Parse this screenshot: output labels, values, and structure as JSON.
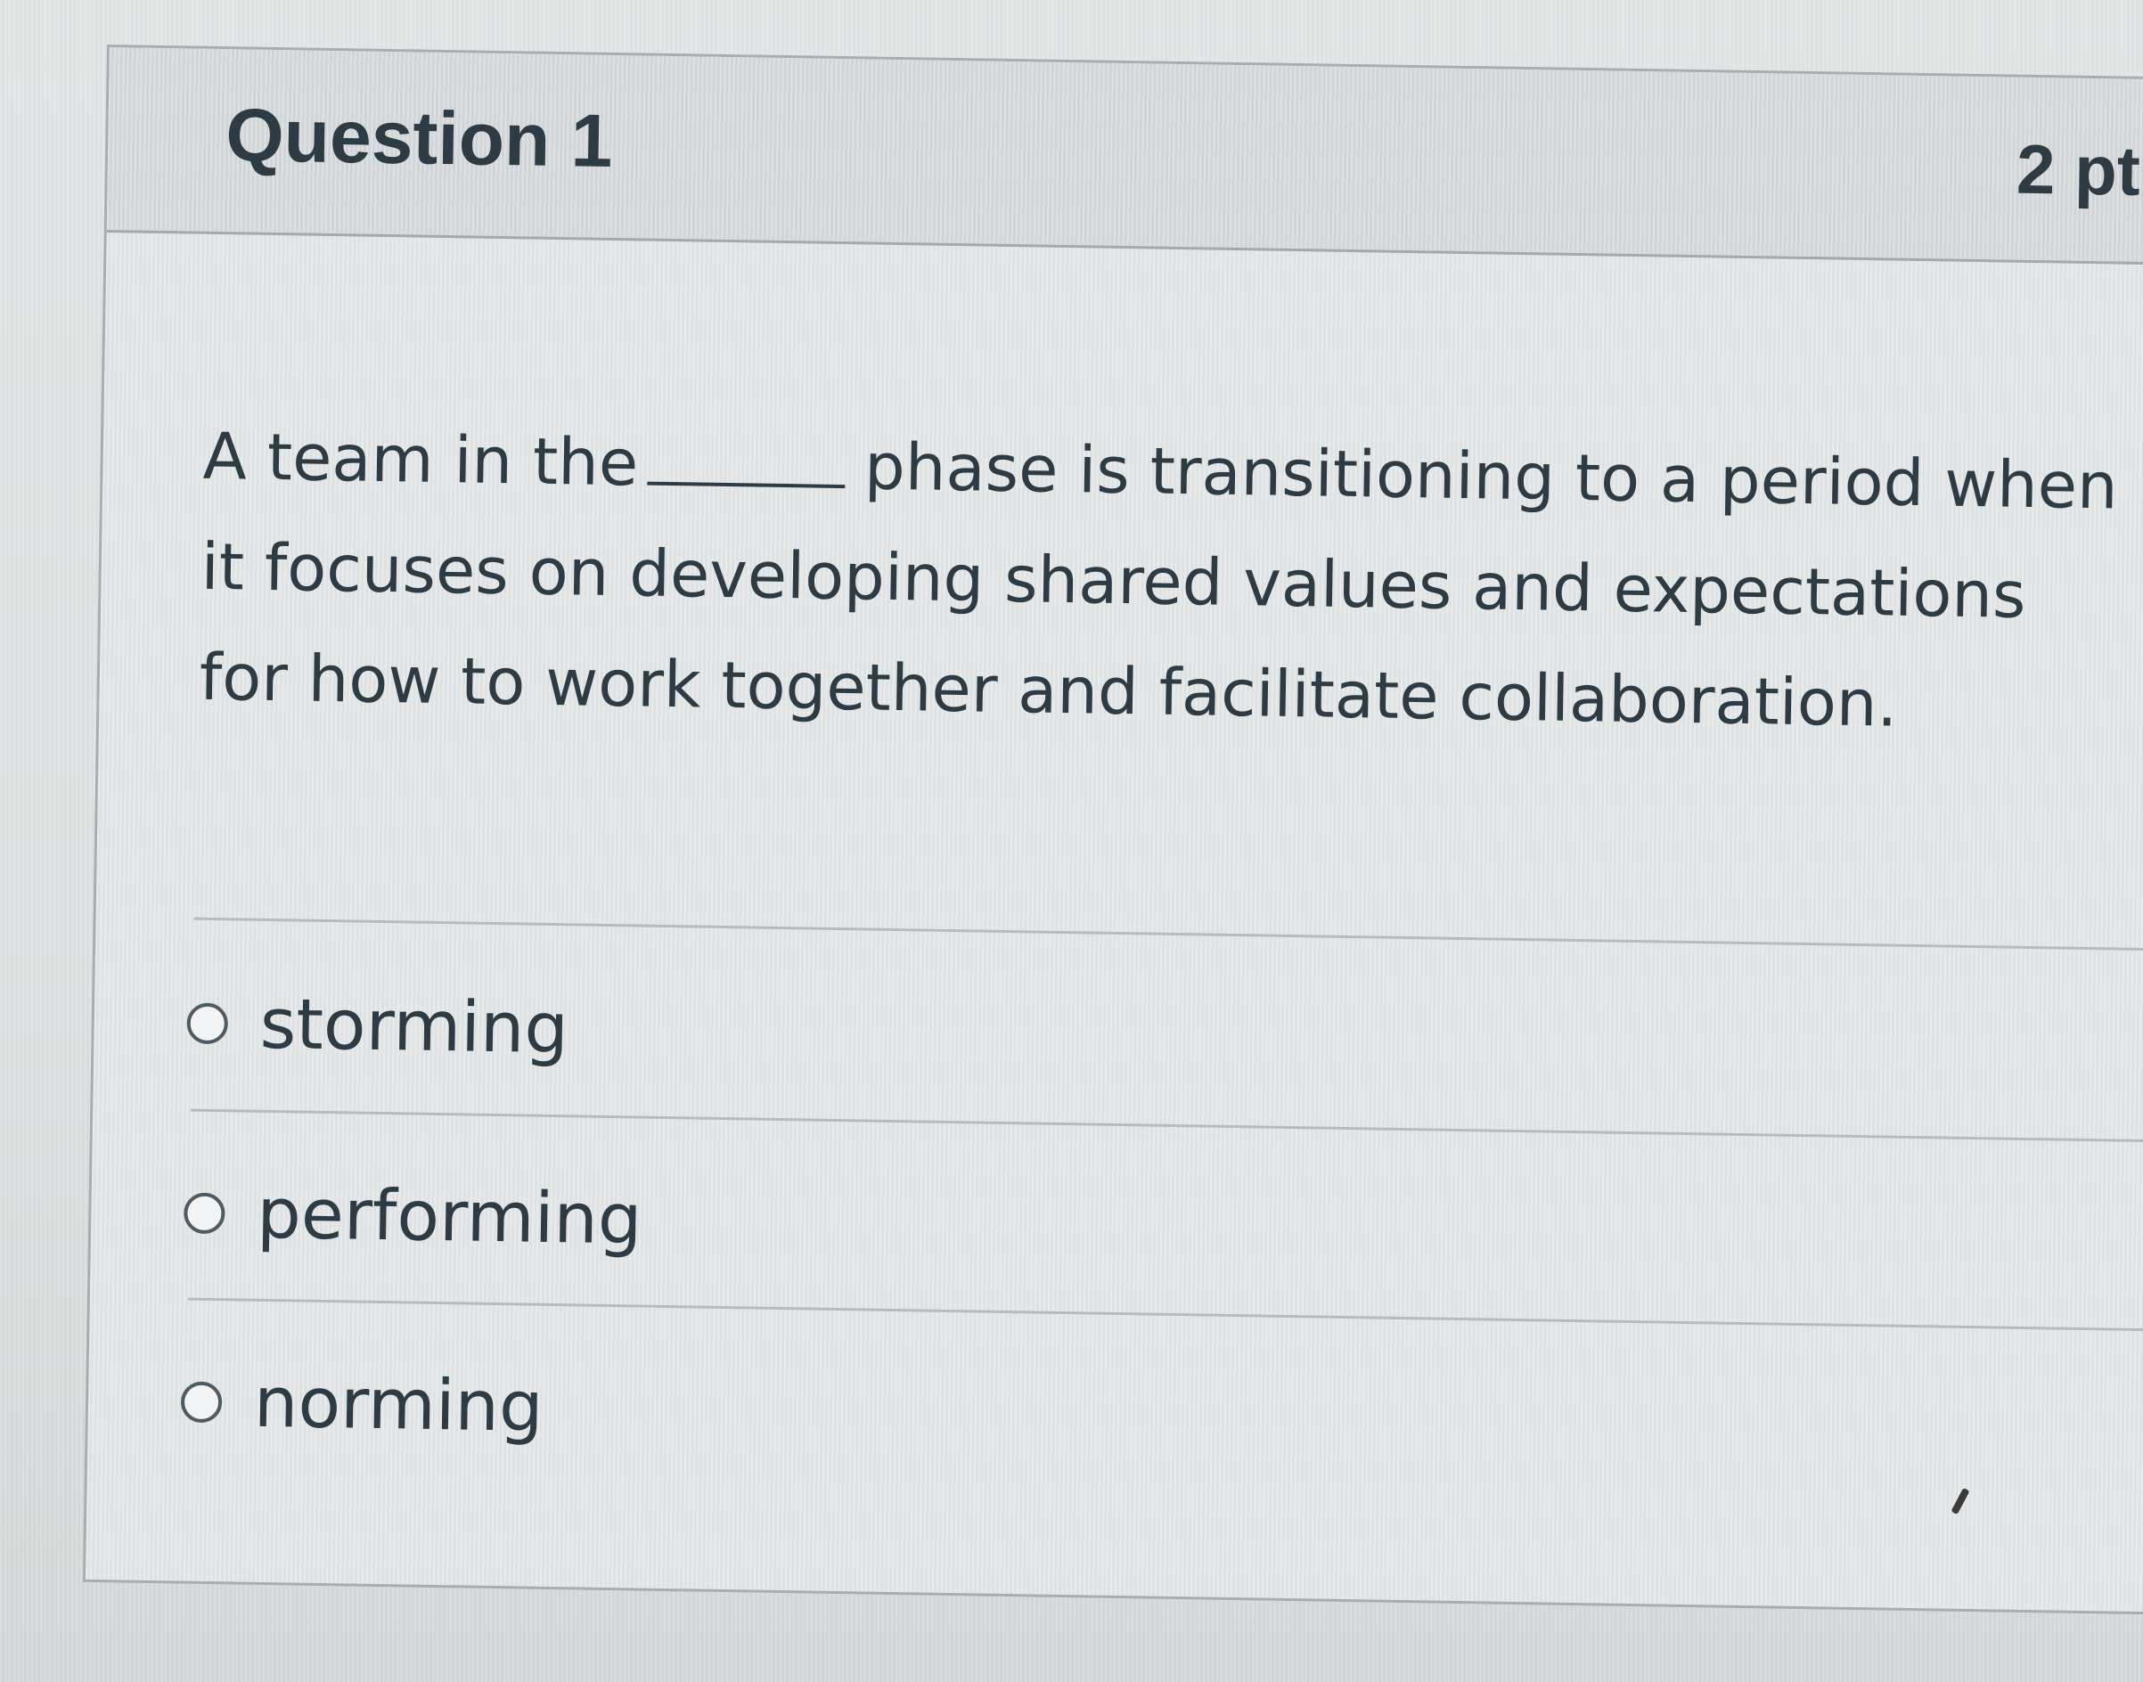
{
  "question": {
    "title": "Question 1",
    "points": "2 pt",
    "text_before_blank": "A team in the",
    "text_after_blank": "phase is transitioning to a period when it focuses on developing shared values and expectations for how to work together and facilitate collaboration."
  },
  "answers": [
    {
      "label": "storming",
      "selected": false
    },
    {
      "label": "performing",
      "selected": false
    },
    {
      "label": "norming",
      "selected": false
    }
  ],
  "icons": {
    "radio": "radio-empty-icon"
  },
  "colors": {
    "text": "#2d3b45",
    "header_bg": "#d9dcde",
    "card_bg": "#e4e7e8",
    "border": "#a9adb0"
  }
}
